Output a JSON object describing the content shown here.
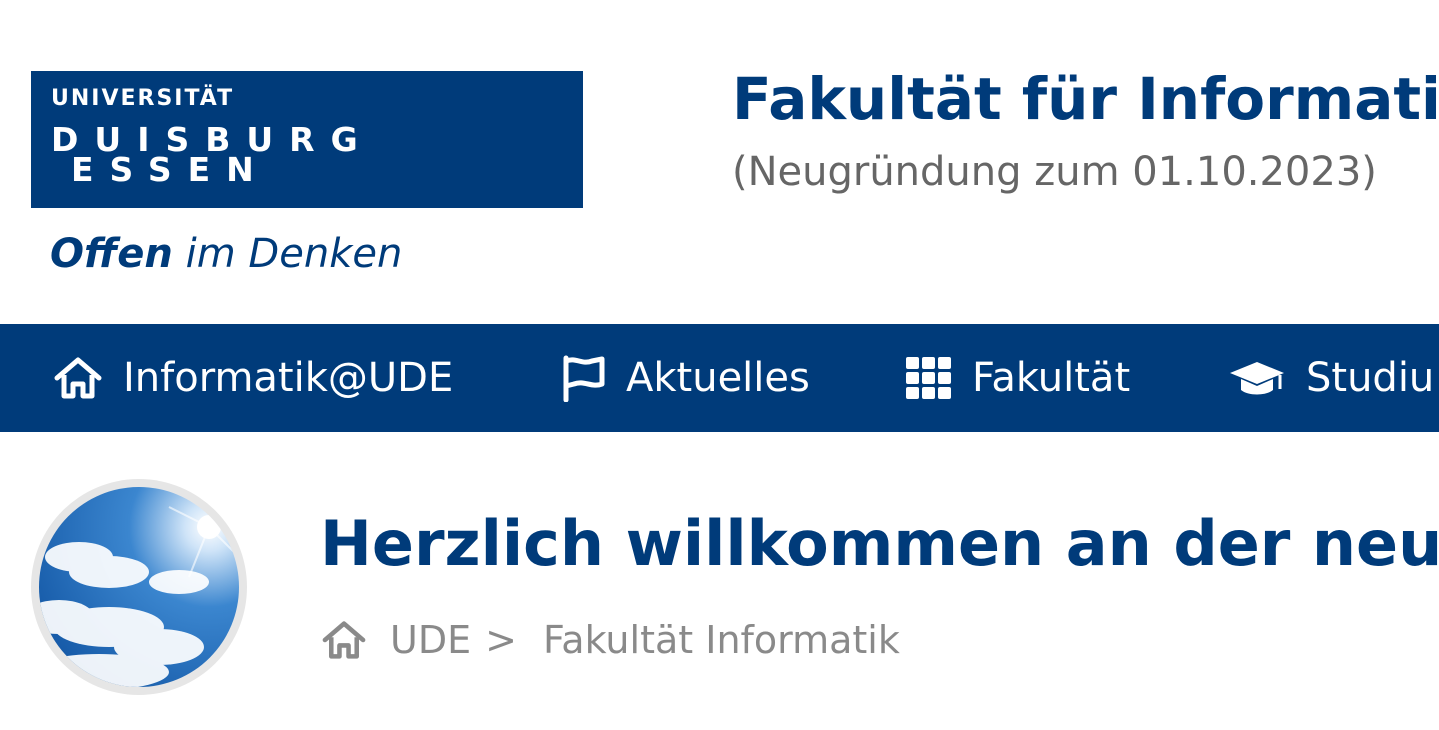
{
  "header": {
    "logo": {
      "line1": "UNIVERSITÄT",
      "line2": "DUISBURG",
      "line3": "ESSEN",
      "tagline_strong": "Offen",
      "tagline_rest": " im Denken"
    },
    "faculty_title": "Fakultät für Informatik",
    "faculty_subtitle": "(Neugründung zum 01.10.2023)"
  },
  "nav": {
    "items": [
      {
        "label": "Informatik@UDE",
        "icon": "home-icon"
      },
      {
        "label": "Aktuelles",
        "icon": "flag-icon"
      },
      {
        "label": "Fakultät",
        "icon": "grid-icon"
      },
      {
        "label": "Studiu",
        "icon": "graduation-cap-icon"
      }
    ]
  },
  "main": {
    "title": "Herzlich willkommen an der neue",
    "breadcrumb": {
      "home": "UDE",
      "separator": ">",
      "current": "Fakultät Informatik"
    }
  },
  "colors": {
    "brand": "#003b7a",
    "text_gray": "#666666",
    "breadcrumb_gray": "#8a8a8a"
  }
}
